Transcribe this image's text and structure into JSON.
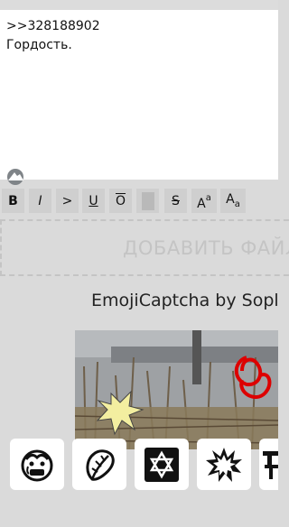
{
  "reply": {
    "text_line1": ">>328188902",
    "text_line2": "Гордость."
  },
  "toolbar": {
    "buttons": [
      {
        "label": "B"
      },
      {
        "label": "I"
      },
      {
        "label": ">"
      },
      {
        "label": "U"
      },
      {
        "label": "O"
      },
      {
        "label": ""
      },
      {
        "label": "S"
      },
      {
        "label_main": "A",
        "label_sup": "a"
      },
      {
        "label_main": "A",
        "label_sub": "a"
      }
    ]
  },
  "dropzone": {
    "label": "ДОБАВИТЬ ФАЙЛ"
  },
  "captcha": {
    "title": "EmojiCaptcha by Sopl",
    "emoji_options": [
      {
        "icon": "crying-face-icon"
      },
      {
        "icon": "lettuce-icon"
      },
      {
        "icon": "star-of-david-icon"
      },
      {
        "icon": "explosion-icon"
      },
      {
        "icon": "tower-icon"
      }
    ]
  }
}
